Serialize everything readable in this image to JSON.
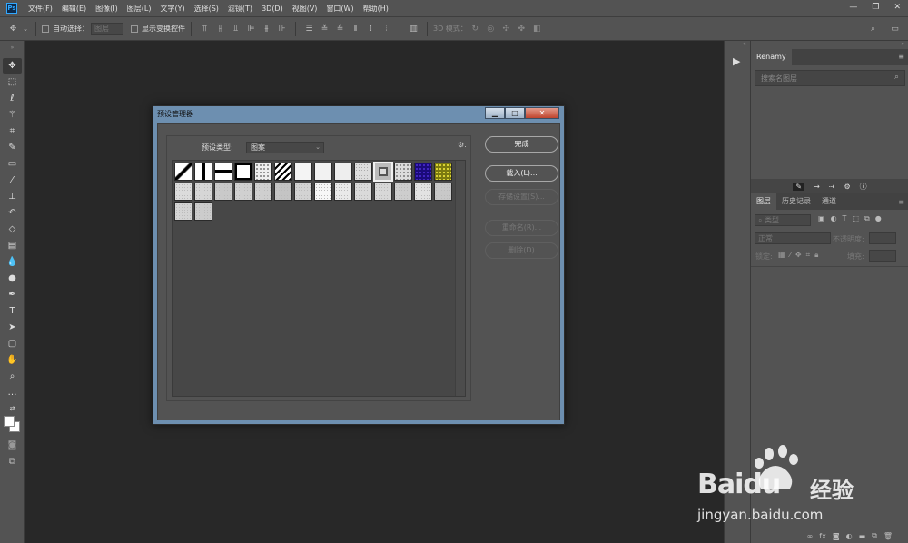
{
  "app": {
    "logo": "Ps"
  },
  "menubar": {
    "items": [
      "文件(F)",
      "编辑(E)",
      "图像(I)",
      "图层(L)",
      "文字(Y)",
      "选择(S)",
      "滤镜(T)",
      "3D(D)",
      "视图(V)",
      "窗口(W)",
      "帮助(H)"
    ],
    "window_controls": [
      "—",
      "❐",
      "✕"
    ]
  },
  "options_bar": {
    "auto_select_label": "自动选择：",
    "auto_select_value": "图层",
    "show_transform_label": "显示变换控件",
    "mode_3d_label": "3D 模式："
  },
  "right_panel": {
    "renamy_tab": "Renamy",
    "search_placeholder": "搜索名图层",
    "layers_tabs": [
      "图层",
      "历史记录",
      "通道"
    ],
    "filter_kind": "类型",
    "blend_mode": "正常",
    "opacity_label": "不透明度:",
    "lock_label": "锁定:",
    "fill_label": "填充:",
    "footer_icons": [
      "link-icon",
      "fx-icon",
      "mask-icon",
      "adjustment-icon",
      "folder-icon",
      "new-layer-icon",
      "trash-icon"
    ]
  },
  "dialog": {
    "title": "预设管理器",
    "preset_type_label": "预设类型:",
    "preset_type_value": "图案",
    "buttons": {
      "done": "完成",
      "load": "载入(L)...",
      "save": "存储设置(S)...",
      "rename": "重命名(R)...",
      "delete": "删除(D)"
    },
    "pattern_count": 30
  },
  "watermark": {
    "brand": "Baidu",
    "brand_cn": "经验",
    "url": "jingyan.baidu.com"
  },
  "colors": {
    "ui_panel": "#535353",
    "canvas": "#282828",
    "dialog_frame": "#6d8fb0",
    "close_button": "#c0452e"
  }
}
